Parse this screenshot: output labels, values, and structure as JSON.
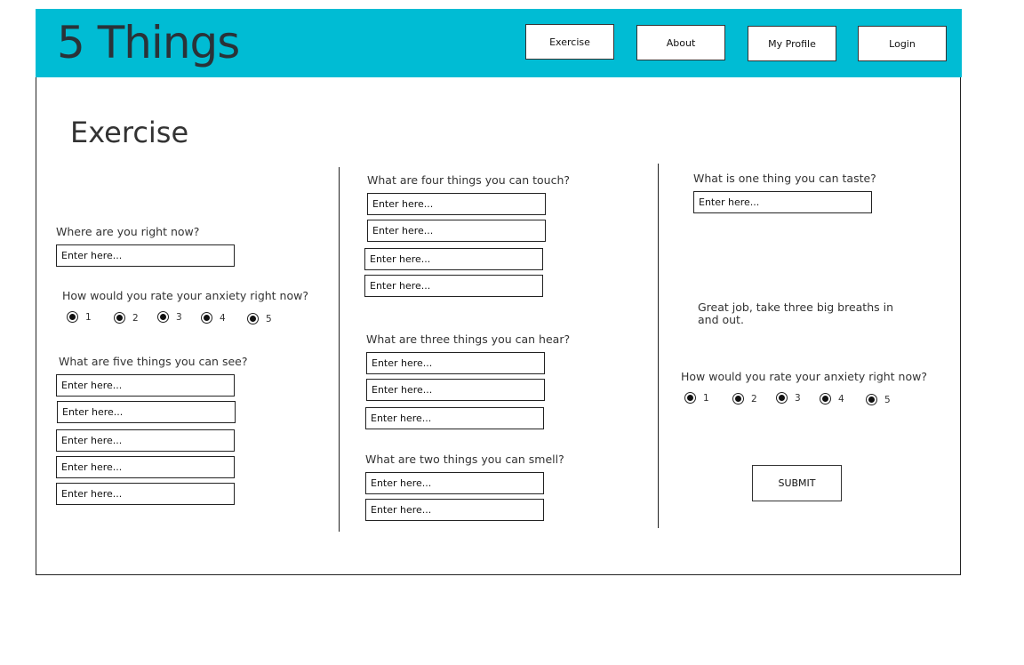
{
  "header": {
    "logo": "5 Things",
    "nav": {
      "exercise": "Exercise",
      "about": "About",
      "profile": "My Profile",
      "login": "Login"
    },
    "color": "#00bcd4"
  },
  "page": {
    "title": "Exercise"
  },
  "form": {
    "placeholder": "Enter here...",
    "location_q": "Where are you right now?",
    "anxiety_q": "How would you rate your anxiety right now?",
    "ratings": [
      "1",
      "2",
      "3",
      "4",
      "5"
    ],
    "see_q": "What are five things you can see?",
    "touch_q": "What are four things you can touch?",
    "hear_q": "What are three things you can hear?",
    "smell_q": "What are two things you can smell?",
    "taste_q": "What is one thing you can taste?",
    "message": "Great job, take three big breaths in and out.",
    "anxiety_after_q": "How would you rate your anxiety right now?",
    "submit": "SUBMIT"
  }
}
